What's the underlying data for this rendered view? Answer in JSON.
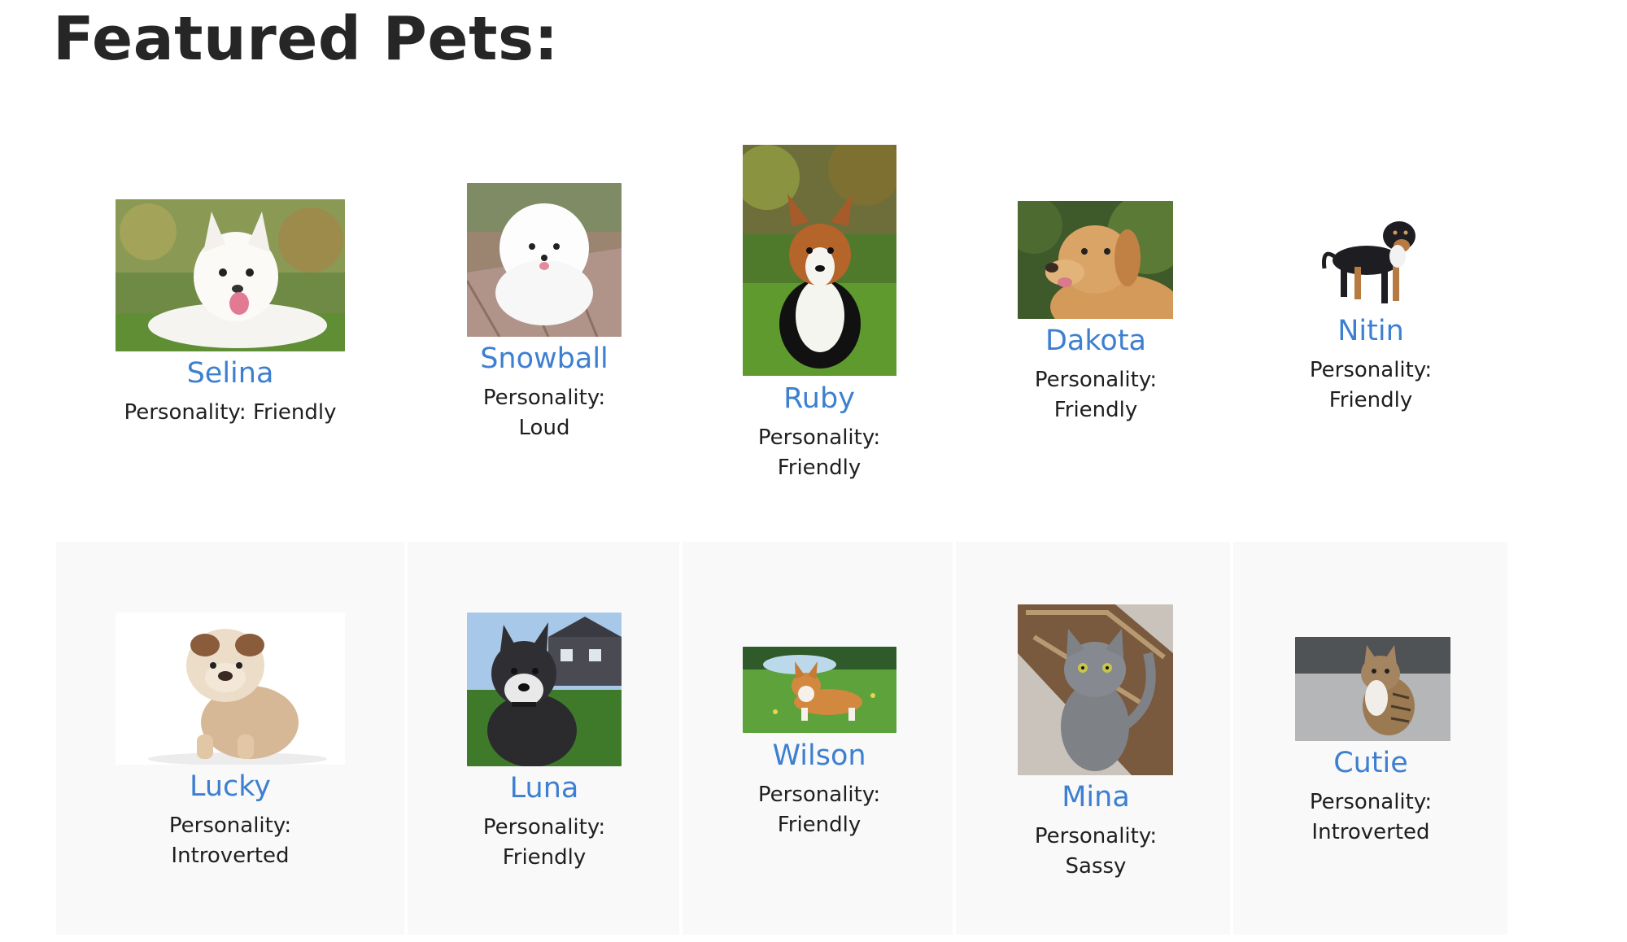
{
  "page": {
    "title": "Featured Pets:"
  },
  "pets": [
    {
      "name": "Selina",
      "personality": "Personality: Friendly",
      "photo": "white-dog-lying-on-grass"
    },
    {
      "name": "Snowball",
      "personality": "Personality: Loud",
      "photo": "white-pomeranian-puppy"
    },
    {
      "name": "Ruby",
      "personality": "Personality: Friendly",
      "photo": "corgi-sitting-on-grass"
    },
    {
      "name": "Dakota",
      "personality": "Personality: Friendly",
      "photo": "golden-labrador"
    },
    {
      "name": "Nitin",
      "personality": "Personality: Friendly",
      "photo": "tricolor-dog-standing"
    },
    {
      "name": "Lucky",
      "personality": "Personality: Introverted",
      "photo": "bulldog-puppy"
    },
    {
      "name": "Luna",
      "personality": "Personality: Friendly",
      "photo": "husky-puppy"
    },
    {
      "name": "Wilson",
      "personality": "Personality: Friendly",
      "photo": "corgi-on-grass"
    },
    {
      "name": "Mina",
      "personality": "Personality: Sassy",
      "photo": "grey-cat-on-rug"
    },
    {
      "name": "Cutie",
      "personality": "Personality: Introverted",
      "photo": "tabby-cat-sitting"
    }
  ],
  "colors": {
    "link": "#3d7fd0",
    "row_background": "#f9f9f9",
    "title": "#262626"
  }
}
